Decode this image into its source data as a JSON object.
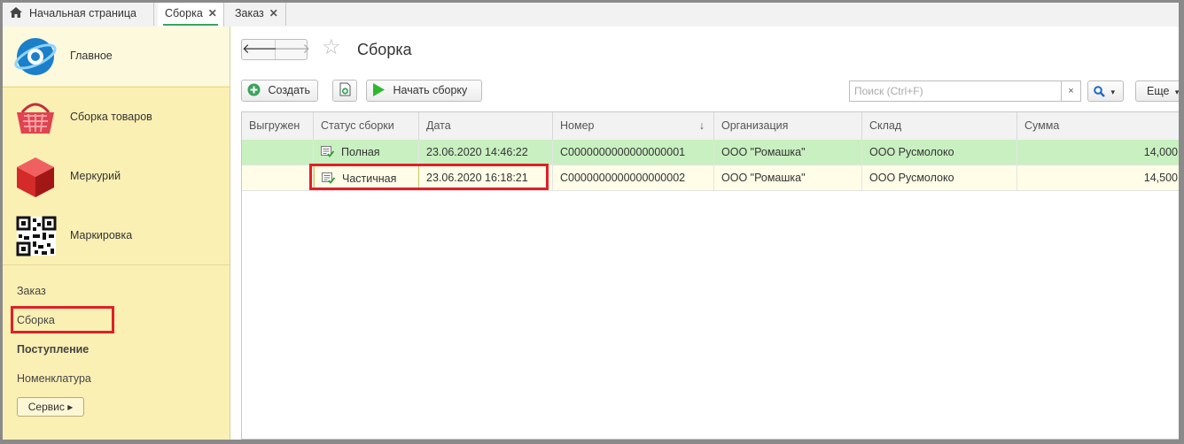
{
  "tabs": [
    {
      "label": "Начальная страница",
      "icon": "home-icon"
    },
    {
      "label": "Сборка",
      "close": "✕",
      "active": true
    },
    {
      "label": "Заказ",
      "close": "✕"
    }
  ],
  "sidebar": {
    "sections": [
      {
        "label": "Главное",
        "icon": "main-logo-icon"
      },
      {
        "label": "Сборка товаров",
        "icon": "basket-icon"
      },
      {
        "label": "Меркурий",
        "icon": "cube-icon"
      },
      {
        "label": "Маркировка",
        "icon": "qr-code-icon"
      }
    ],
    "links": [
      {
        "label": "Заказ"
      },
      {
        "label": "Сборка"
      },
      {
        "label": "Поступление"
      },
      {
        "label": "Номенклатура"
      }
    ],
    "service_label": "Сервис ▸"
  },
  "main": {
    "nav": {
      "back": "🡐",
      "forward": "🡒"
    },
    "star": "☆",
    "title": "Сборка",
    "toolbar": {
      "create_label": "Создать",
      "start_label": "Начать сборку",
      "search_placeholder": "Поиск (Ctrl+F)",
      "clear": "×",
      "more_label": "Еще"
    },
    "table": {
      "columns": [
        "Выгружен",
        "Статус сборки",
        "Дата",
        "Номер",
        "Организация",
        "Склад",
        "Сумма"
      ],
      "sort_indicator": "↓",
      "rows": [
        {
          "unloaded": "",
          "status": "Полная",
          "date": "23.06.2020 14:46:22",
          "number": "С0000000000000000001",
          "org": "ООО \"Ромашка\"",
          "warehouse": "ООО Русмолоко",
          "sum": "14,000"
        },
        {
          "unloaded": "",
          "status": "Частичная",
          "date": "23.06.2020 16:18:21",
          "number": "С0000000000000000002",
          "org": "ООО \"Ромашка\"",
          "warehouse": "ООО Русмолоко",
          "sum": "14,500"
        }
      ]
    }
  },
  "colors": {
    "sidebar_bg": "#fbf0b4",
    "row_complete": "#c9f0c1",
    "row_selected": "#fffde7",
    "highlight": "#e21f26",
    "accent_green": "#3aa35b"
  }
}
